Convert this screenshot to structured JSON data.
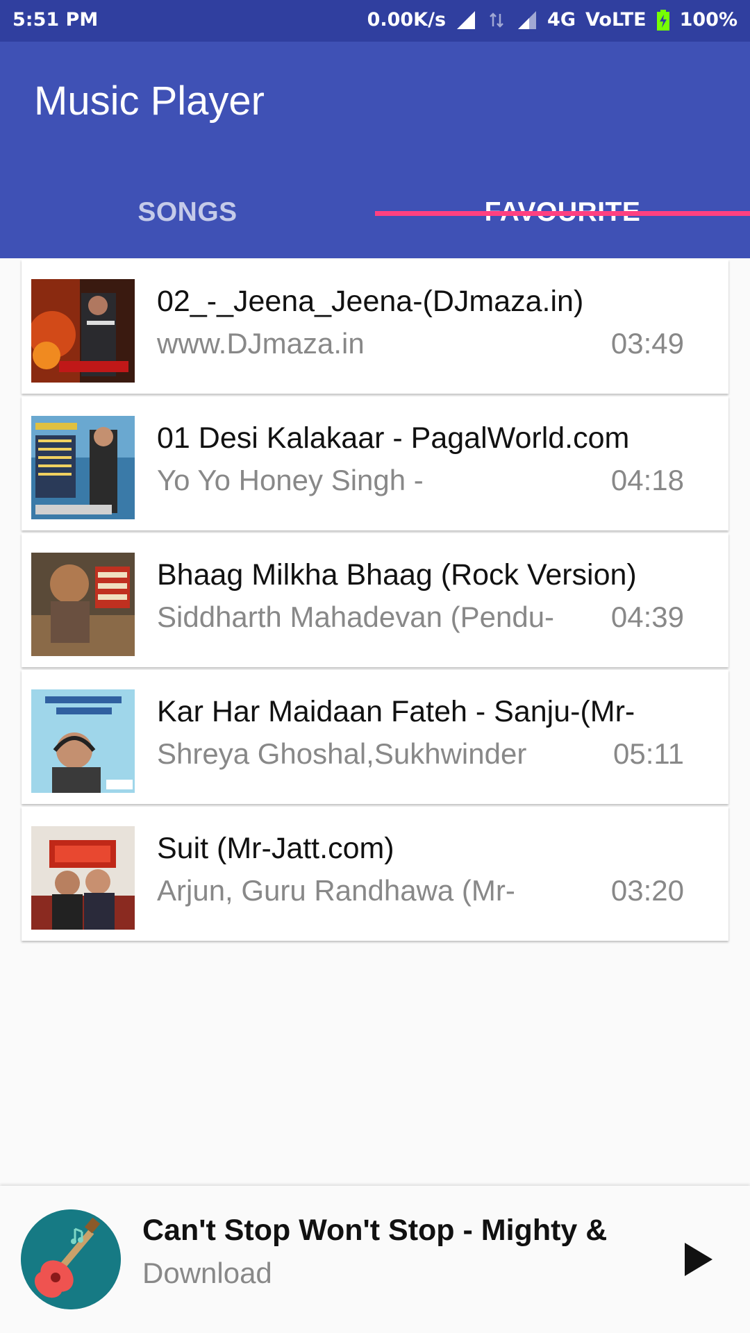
{
  "status_bar": {
    "time": "5:51 PM",
    "speed": "0.00K/s",
    "network": "4G",
    "volte": "VoLTE",
    "battery": "100%"
  },
  "app": {
    "title": "Music Player",
    "primary_color": "#3f51b5",
    "status_color": "#303f9f",
    "accent_color": "#ff4081"
  },
  "tabs": [
    {
      "label": "SONGS",
      "selected": false
    },
    {
      "label": "FAVOURITE",
      "selected": true
    }
  ],
  "songs": [
    {
      "title": "02_-_Jeena_Jeena-(DJmaza.in)",
      "artist": "www.DJmaza.in",
      "duration": "03:49",
      "art_icon": "album-art-badlapur"
    },
    {
      "title": "01 Desi Kalakaar - PagalWorld.com",
      "artist": "Yo Yo Honey Singh -",
      "duration": "04:18",
      "art_icon": "album-art-desi-kalakaar"
    },
    {
      "title": "Bhaag Milkha Bhaag (Rock Version)",
      "artist": "Siddharth Mahadevan (Pendu-",
      "duration": "04:39",
      "art_icon": "album-art-bhaag-milkha-bhaag"
    },
    {
      "title": "Kar Har Maidaan Fateh - Sanju-(Mr-",
      "artist": "Shreya Ghoshal,Sukhwinder",
      "duration": "05:11",
      "art_icon": "album-art-sanju"
    },
    {
      "title": "Suit (Mr-Jatt.com)",
      "artist": "Arjun, Guru Randhawa (Mr-",
      "duration": "03:20",
      "art_icon": "album-art-suit"
    }
  ],
  "now_playing": {
    "title": "Can't Stop Won't Stop - Mighty &",
    "subtitle": "Download",
    "art_icon": "guitar-icon",
    "control_icon": "play-icon"
  }
}
